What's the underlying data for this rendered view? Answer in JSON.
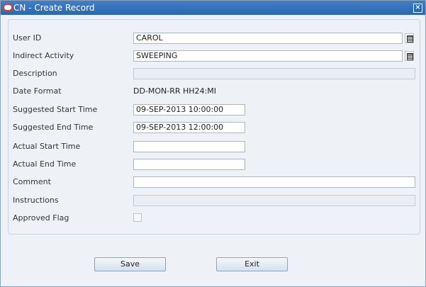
{
  "window": {
    "title": "CN - Create Record",
    "close_symbol": "×"
  },
  "form": {
    "user_id": {
      "label": "User ID",
      "value": "CAROL"
    },
    "indirect_activity": {
      "label": "Indirect Activity",
      "value": "SWEEPING"
    },
    "description": {
      "label": "Description",
      "value": ""
    },
    "date_format": {
      "label": "Date Format",
      "value": "DD-MON-RR HH24:MI"
    },
    "suggested_start_time": {
      "label": "Suggested Start Time",
      "value": "09-SEP-2013 10:00:00"
    },
    "suggested_end_time": {
      "label": "Suggested End Time",
      "value": "09-SEP-2013 12:00:00"
    },
    "actual_start_time": {
      "label": "Actual Start Time",
      "value": ""
    },
    "actual_end_time": {
      "label": "Actual End Time",
      "value": ""
    },
    "comment": {
      "label": "Comment",
      "value": ""
    },
    "instructions": {
      "label": "Instructions",
      "value": ""
    },
    "approved_flag": {
      "label": "Approved Flag",
      "checked": false
    }
  },
  "buttons": {
    "save": "Save",
    "exit": "Exit"
  },
  "icons": {
    "app_logo": "oracle-logo-icon",
    "lov": "list-of-values-icon",
    "close": "close-icon"
  },
  "colors": {
    "titlebar": "#2d66ab",
    "background": "#eef2f7",
    "logo": "#e23b2e"
  }
}
